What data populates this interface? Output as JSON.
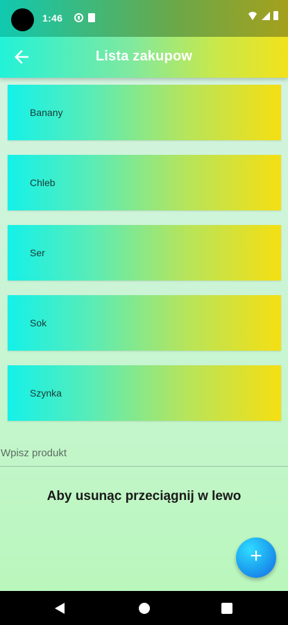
{
  "status_bar": {
    "time": "1:46",
    "icons": [
      "notification-icon",
      "sim-icon",
      "wifi-icon",
      "signal-icon",
      "battery-icon"
    ]
  },
  "app_bar": {
    "title": "Lista zakupow",
    "back_icon": "arrow-left-icon"
  },
  "list": {
    "items": [
      {
        "label": "Banany"
      },
      {
        "label": "Chleb"
      },
      {
        "label": "Ser"
      },
      {
        "label": "Sok"
      },
      {
        "label": "Szynka"
      }
    ]
  },
  "input": {
    "placeholder": "Wpisz produkt",
    "value": ""
  },
  "hint": "Aby usunąc przeciągnij w lewo",
  "fab": {
    "icon": "plus-icon",
    "symbol": "+"
  },
  "colors": {
    "gradient_start": "#14f1e9",
    "gradient_end": "#f5df12",
    "fab": "#1c9ff0"
  }
}
